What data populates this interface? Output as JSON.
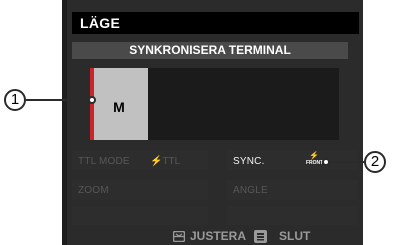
{
  "screen": {
    "title": "LÄGE",
    "section_title": "SYNKRONISERA TERMINAL",
    "mode_value": "M"
  },
  "settings": {
    "ttl_mode_label": "TTL MODE",
    "ttl_mode_value": "⚡TTL",
    "sync_label": "SYNC.",
    "sync_icon_bolt": "⚡",
    "sync_icon_text": "FRONT",
    "zoom_label": "ZOOM",
    "angle_label": "ANGLE"
  },
  "footer": {
    "adjust_label": "JUSTERA",
    "end_label": "SLUT",
    "adjust_icon": "dpad-icon",
    "end_icon": "disp-back-icon"
  },
  "callouts": {
    "one": "1",
    "two": "2"
  },
  "colors": {
    "mode_marker": "#c8262b",
    "screen_bg": "#2b2b2b",
    "mode_bg": "#c1c1c1"
  }
}
